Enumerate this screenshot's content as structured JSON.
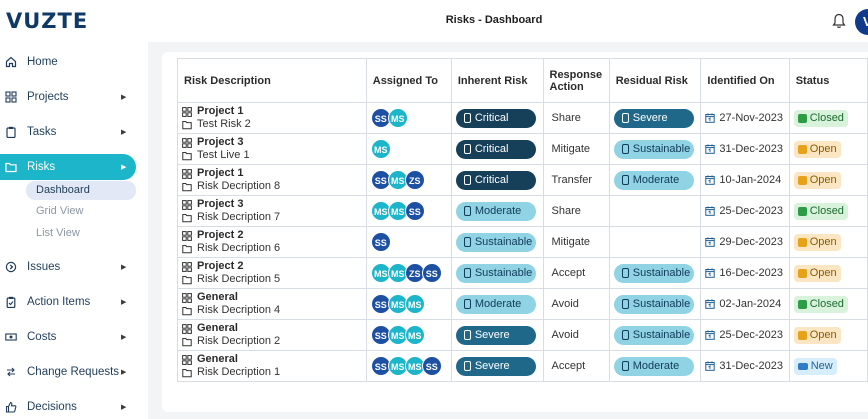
{
  "app": {
    "logo": "VUZTE",
    "title": "Risks - Dashboard",
    "user_initial": "V"
  },
  "sidebar": {
    "items": [
      {
        "label": "Home",
        "icon": "home-icon",
        "has_arrow": false
      },
      {
        "label": "Projects",
        "icon": "grid-icon",
        "has_arrow": true
      },
      {
        "label": "Tasks",
        "icon": "clipboard-icon",
        "has_arrow": true
      },
      {
        "label": "Risks",
        "icon": "folder-icon",
        "has_arrow": true,
        "active": true
      },
      {
        "label": "Issues",
        "icon": "issue-icon",
        "has_arrow": true
      },
      {
        "label": "Action Items",
        "icon": "action-icon",
        "has_arrow": true
      },
      {
        "label": "Costs",
        "icon": "money-icon",
        "has_arrow": true
      },
      {
        "label": "Change Requests",
        "icon": "change-icon",
        "has_arrow": true
      },
      {
        "label": "Decisions",
        "icon": "thumb-icon",
        "has_arrow": true
      }
    ],
    "risk_sub": [
      {
        "label": "Dashboard",
        "active": true
      },
      {
        "label": "Grid View"
      },
      {
        "label": "List View"
      }
    ]
  },
  "table": {
    "headers": [
      "Risk Description",
      "Assigned To",
      "Inherent Risk",
      "Response Action",
      "Residual Risk",
      "Identified On",
      "Status"
    ],
    "rows": [
      {
        "project": "Project 1",
        "risk": "Test Risk 2",
        "assigned": [
          "SS",
          "MS"
        ],
        "inherent": "Critical",
        "response": "Share",
        "residual": "Severe",
        "date": "27-Nov-2023",
        "status": "Closed"
      },
      {
        "project": "Project 3",
        "risk": "Test Live 1",
        "assigned": [
          "MS"
        ],
        "inherent": "Critical",
        "response": "Mitigate",
        "residual": "Sustainable",
        "date": "31-Dec-2023",
        "status": "Open"
      },
      {
        "project": "Project 1",
        "risk": "Risk Decription 8",
        "assigned": [
          "SS",
          "MS",
          "ZS"
        ],
        "inherent": "Critical",
        "response": "Transfer",
        "residual": "Moderate",
        "date": "10-Jan-2024",
        "status": "Open"
      },
      {
        "project": "Project 3",
        "risk": "Risk Decription 7",
        "assigned": [
          "MS",
          "MS",
          "SS"
        ],
        "inherent": "Moderate",
        "response": "Share",
        "residual": "",
        "date": "25-Dec-2023",
        "status": "Closed"
      },
      {
        "project": "Project 2",
        "risk": "Risk Decription 6",
        "assigned": [
          "SS"
        ],
        "inherent": "Sustainable",
        "response": "Mitigate",
        "residual": "",
        "date": "29-Dec-2023",
        "status": "Open"
      },
      {
        "project": "Project 2",
        "risk": "Risk Decription 5",
        "assigned": [
          "MS",
          "MS",
          "ZS",
          "SS"
        ],
        "inherent": "Sustainable",
        "response": "Accept",
        "residual": "Sustainable",
        "date": "16-Dec-2023",
        "status": "Open"
      },
      {
        "project": "General",
        "risk": "Risk Decription 4",
        "assigned": [
          "SS",
          "MS",
          "MS"
        ],
        "inherent": "Moderate",
        "response": "Avoid",
        "residual": "Sustainable",
        "date": "02-Jan-2024",
        "status": "Closed"
      },
      {
        "project": "General",
        "risk": "Risk Decription 2",
        "assigned": [
          "SS",
          "MS",
          "MS"
        ],
        "inherent": "Severe",
        "response": "Avoid",
        "residual": "Sustainable",
        "date": "25-Dec-2023",
        "status": "Open"
      },
      {
        "project": "General",
        "risk": "Risk Decription 1",
        "assigned": [
          "SS",
          "MS",
          "MS",
          "SS"
        ],
        "inherent": "Severe",
        "response": "Accept",
        "residual": "Moderate",
        "date": "31-Dec-2023",
        "status": "New"
      }
    ]
  },
  "colors": {
    "accent": "#1cb5c9",
    "brand": "#0f3a68",
    "critical": "#163f5a",
    "severe": "#1f6889",
    "light_risk": "#8fd3e4"
  }
}
